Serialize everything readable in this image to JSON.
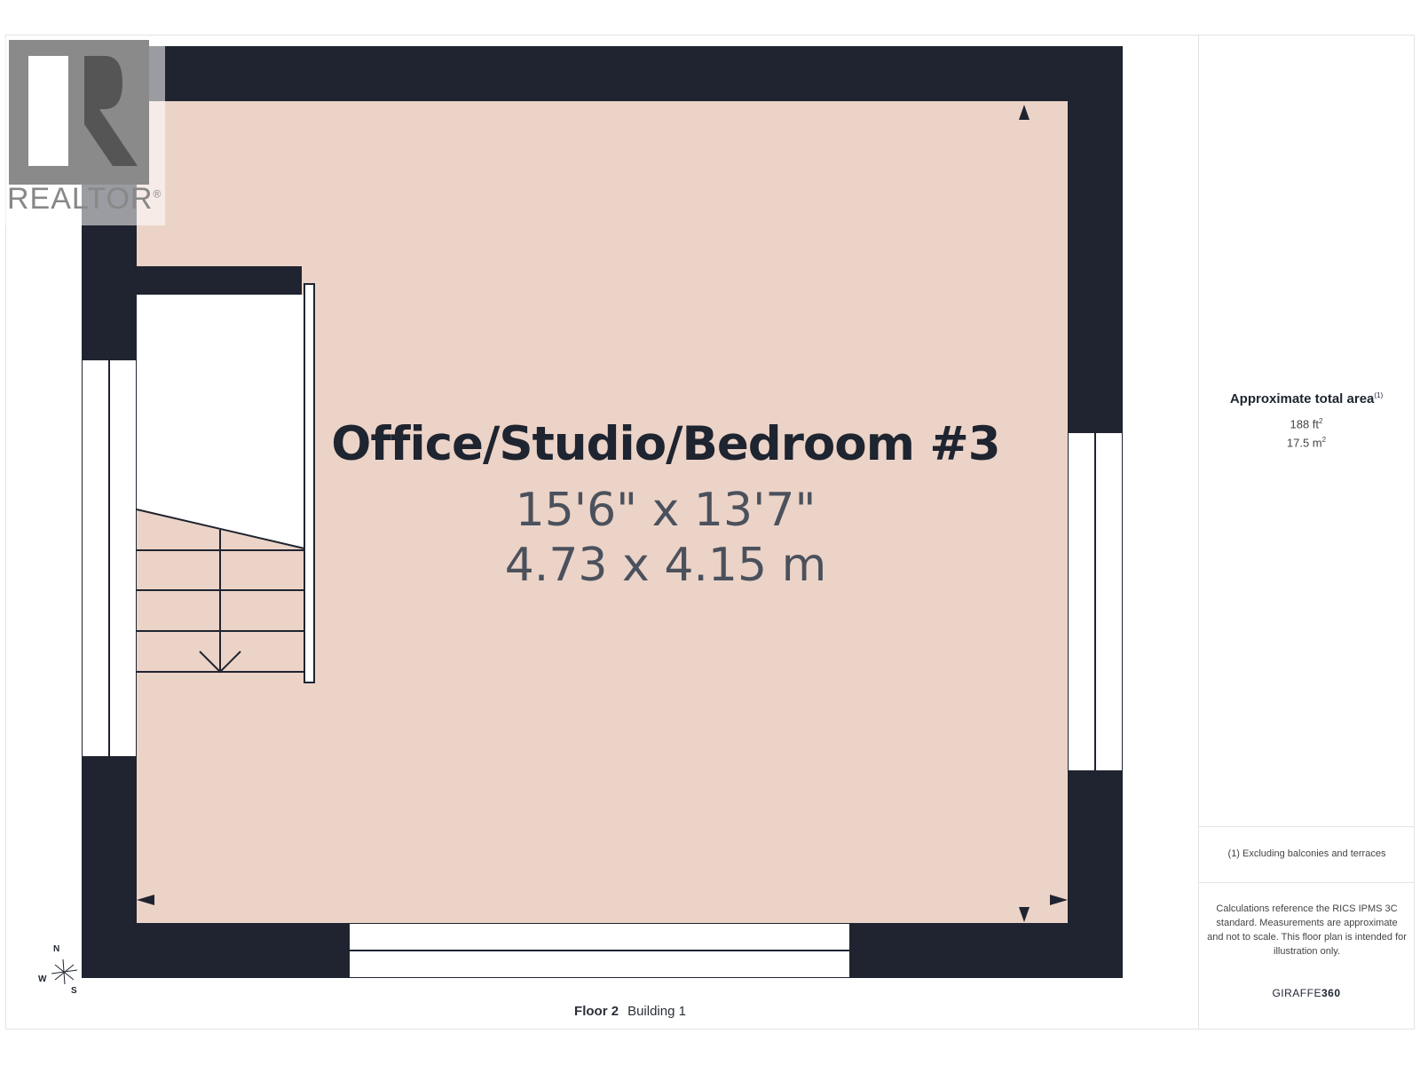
{
  "logo": {
    "text": "REALTOR",
    "mark": "®"
  },
  "room": {
    "name": "Office/Studio/Bedroom #3",
    "dim_imperial": "15'6\" x 13'7\"",
    "dim_metric": "4.73 x 4.15 m"
  },
  "floor": {
    "floor": "Floor 2",
    "building": "Building 1"
  },
  "sidebar": {
    "title": "Approximate total area",
    "title_note": "(1)",
    "area_ft": "188 ft",
    "area_m": "17.5 m",
    "sq": "2",
    "footnote": "(1) Excluding balconies and terraces",
    "disclaimer": "Calculations reference the RICS IPMS 3C standard. Measurements are approximate and not to scale. This floor plan is intended for illustration only.",
    "brand_light": "GIRAFFE",
    "brand_bold": "360"
  },
  "compass": {
    "n": "N",
    "w": "W",
    "s": "S"
  },
  "colors": {
    "wall": "#1f2430",
    "floor": "#ecd3c7",
    "window": "#ffffff"
  }
}
